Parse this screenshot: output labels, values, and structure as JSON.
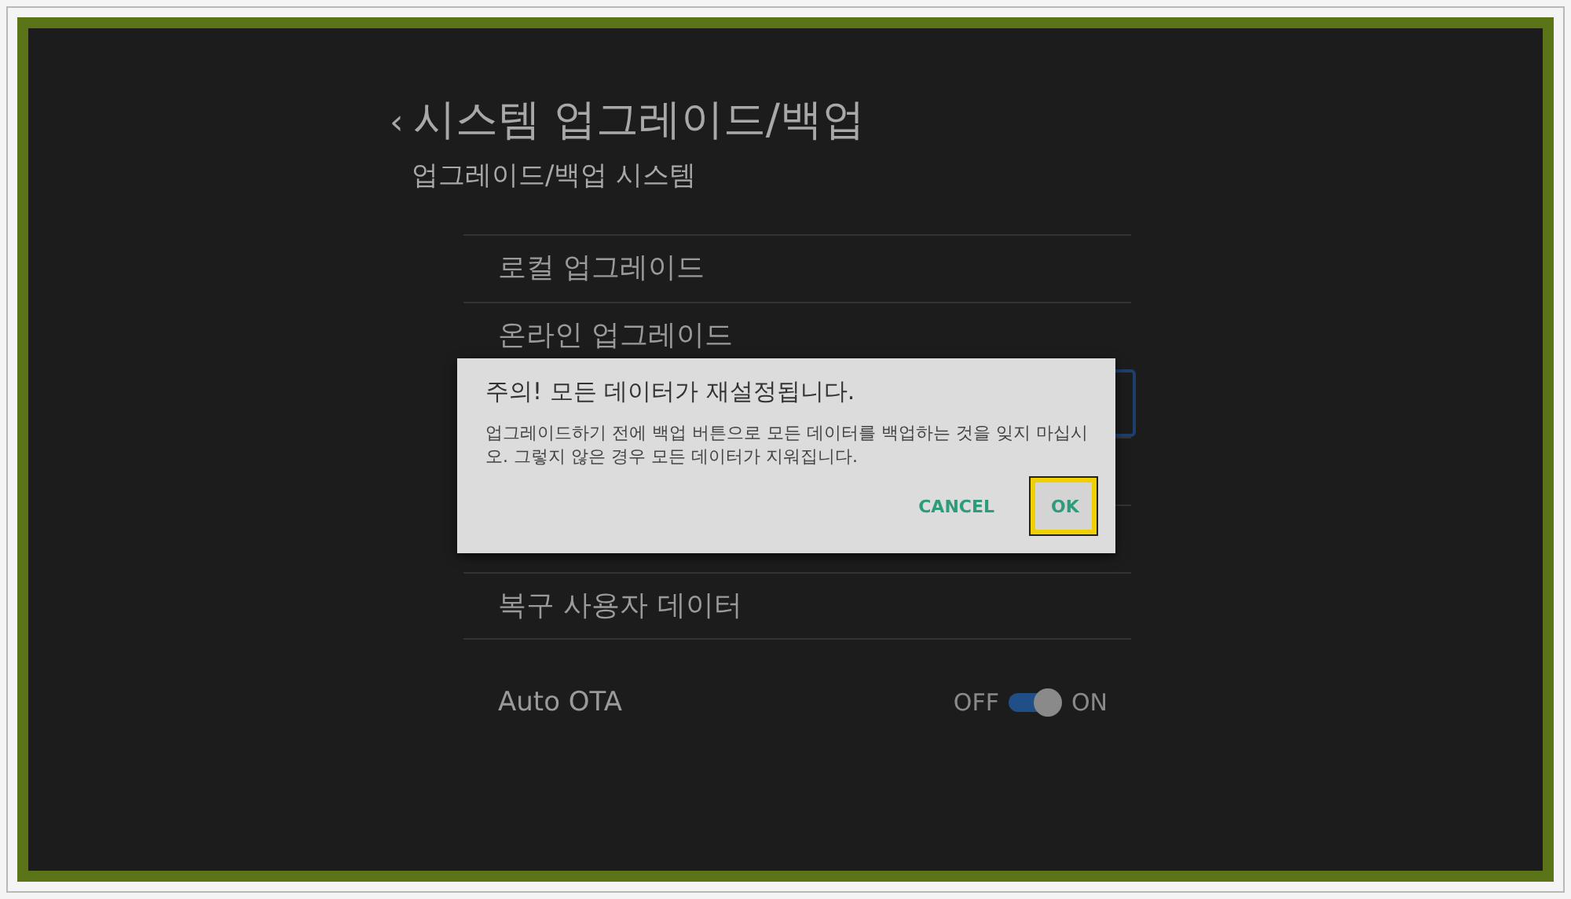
{
  "header": {
    "back": "‹",
    "title": "시스템 업그레이드/백업",
    "subtitle": "업그레이드/백업 시스템"
  },
  "menu_items": [
    {
      "kind": "text",
      "label": "로컬 업그레이드"
    },
    {
      "kind": "text",
      "label": "온라인 업그레이드"
    },
    {
      "kind": "focused"
    },
    {
      "kind": "covered"
    },
    {
      "kind": "covered"
    },
    {
      "kind": "text",
      "label": "복구 사용자 데이터"
    }
  ],
  "auto_ota": {
    "label": "Auto OTA",
    "off_label": "OFF",
    "on_label": "ON",
    "on": true
  },
  "dialog": {
    "title": "주의! 모든 데이터가 재설정됩니다.",
    "message": "업그레이드하기 전에 백업 버튼으로 모든 데이터를 백업하는 것을 잊지 마십시오. 그렇지 않은 경우 모든 데이터가 지워집니다.",
    "buttons": [
      {
        "label": "CANCEL",
        "focused": false
      },
      {
        "label": "OK",
        "focused": true
      }
    ]
  }
}
